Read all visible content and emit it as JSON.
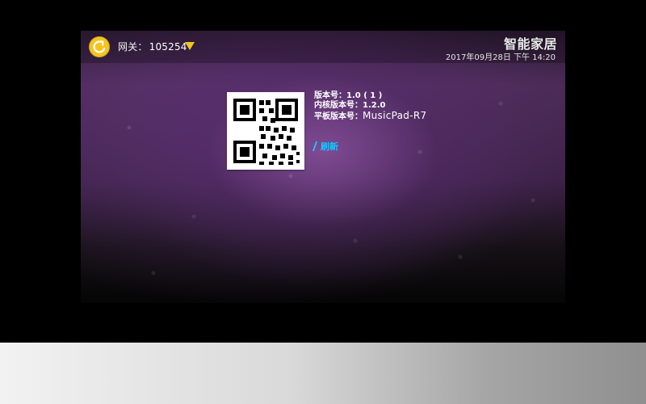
{
  "topbar": {
    "refresh_icon": "refresh-icon",
    "gateway_label": "网关：",
    "gateway_value": "105254",
    "dropdown_icon": "triangle-down-icon",
    "brand": "智能家居",
    "datetime": "2017年09月28日 下午 14:20"
  },
  "info": {
    "version_label": "版本号：",
    "version_value": "1.0 ( 1 )",
    "kernel_label": "内核版本号：",
    "kernel_value": "1.2.0",
    "pad_label": "平板版本号：",
    "pad_value": "MusicPad-R7",
    "refresh_link": "刷新"
  },
  "colors": {
    "accent_yellow": "#f5c51c",
    "link_cyan": "#18c7ff",
    "text_white": "#ffffff"
  }
}
